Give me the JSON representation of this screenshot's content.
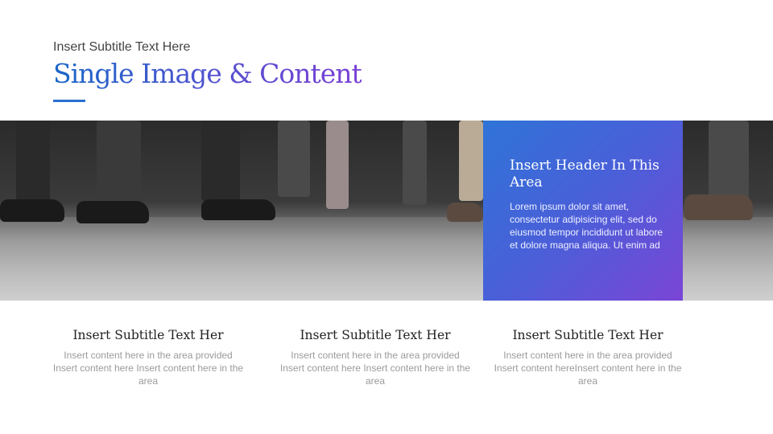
{
  "header": {
    "subtitle": "Insert Subtitle Text Here",
    "title": "Single Image & Content"
  },
  "feature": {
    "header": "Insert Header In This Area",
    "body": "Lorem ipsum dolor sit amet, consectetur adipisicing elit, sed do eiusmod tempor incididunt ut labore et dolore magna aliqua. Ut enim ad"
  },
  "columns": [
    {
      "title": "Insert Subtitle Text Her",
      "body": "Insert content here in the area provided Insert content here Insert content here in the area"
    },
    {
      "title": "Insert Subtitle Text Her",
      "body": "Insert content here in the area provided Insert content here Insert content here in the area"
    },
    {
      "title": "Insert Subtitle Text Her",
      "body": "Insert content here in the area provided Insert content hereInsert content here in the area"
    }
  ],
  "colors": {
    "accent_start": "#1a67c8",
    "accent_end": "#7a3fd6",
    "box_start": "#2f74d8",
    "box_end": "#7b45d6"
  }
}
